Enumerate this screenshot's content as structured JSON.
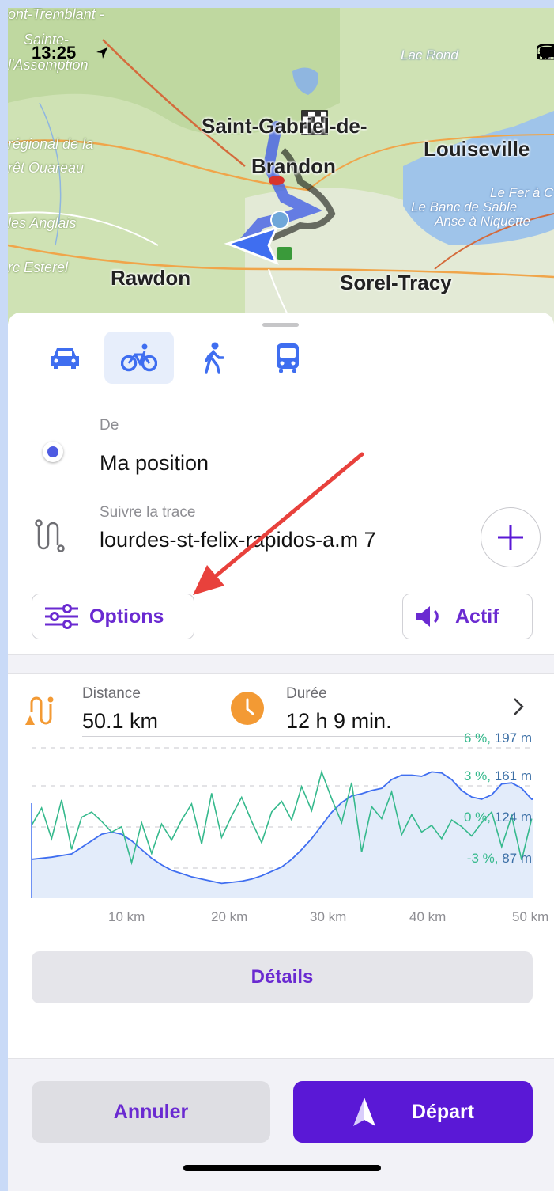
{
  "status": {
    "time": "13:25"
  },
  "map": {
    "labels": {
      "tremblant": "ont-Tremblant -",
      "assomption": "l'Assomption",
      "sainte": "Sainte-",
      "lac_rond": "Lac Rond",
      "saint_gabriel": "Saint-Gabriel-de-",
      "brandon": "Brandon",
      "louiseville": "Louiseville",
      "regional": "régional de la",
      "ouareau": "rêt Ouareau",
      "fer": "Le Fer à C",
      "banc": "Le Banc de Sable",
      "anse": "Anse à Niquette",
      "anglais": "les Anglais",
      "esterel": "rc Esterel",
      "rawdon": "Rawdon",
      "sorel": "Sorel-Tracy"
    }
  },
  "modes": [
    {
      "name": "car",
      "active": false
    },
    {
      "name": "bicycle",
      "active": true
    },
    {
      "name": "walk",
      "active": false
    },
    {
      "name": "bus",
      "active": false
    }
  ],
  "route": {
    "from_label": "De",
    "from_value": "Ma position",
    "track_label": "Suivre la trace",
    "track_value": "lourdes-st-felix-rapidos-a.m 7"
  },
  "buttons": {
    "options": "Options",
    "voice": "Actif",
    "details": "Détails",
    "cancel": "Annuler",
    "start": "Départ"
  },
  "summary": {
    "distance_label": "Distance",
    "distance_value": "50.1 km",
    "duration_label": "Durée",
    "duration_value": "12 h 9 min."
  },
  "chart_data": {
    "type": "area",
    "x_ticks": [
      "10 km",
      "20 km",
      "30 km",
      "40 km",
      "50 km"
    ],
    "right_labels": [
      {
        "grade": "6 %",
        "elev": "197 m"
      },
      {
        "grade": "3 %",
        "elev": "161 m"
      },
      {
        "grade": "0 %",
        "elev": "124 m"
      },
      {
        "grade": "-3 %",
        "elev": "87 m"
      }
    ],
    "xlim": [
      0,
      50.1
    ],
    "elevation_ylim": [
      87,
      197
    ],
    "grade_ylim": [
      -3,
      6
    ],
    "elevation": {
      "x": [
        0,
        2,
        4,
        5,
        6,
        7,
        8,
        9,
        10,
        11,
        12,
        13,
        14,
        15,
        16,
        17,
        18,
        19,
        20,
        21,
        22,
        23,
        24,
        25,
        26,
        27,
        28,
        29,
        30,
        31,
        32,
        33,
        34,
        35,
        36,
        37,
        38,
        39,
        40,
        41,
        42,
        43,
        44,
        45,
        46,
        47,
        48,
        49,
        50,
        50.1
      ],
      "y": [
        95,
        97,
        100,
        106,
        112,
        118,
        120,
        118,
        112,
        104,
        96,
        90,
        85,
        82,
        79,
        77,
        75,
        73,
        74,
        75,
        77,
        80,
        84,
        88,
        95,
        104,
        114,
        126,
        138,
        147,
        153,
        155,
        158,
        160,
        168,
        172,
        172,
        171,
        175,
        174,
        168,
        158,
        152,
        150,
        154,
        164,
        165,
        160,
        150,
        150
      ]
    },
    "grade": {
      "x": [
        0,
        1,
        2,
        3,
        4,
        5,
        6,
        7,
        8,
        9,
        10,
        11,
        12,
        13,
        14,
        15,
        16,
        17,
        18,
        19,
        20,
        21,
        22,
        23,
        24,
        25,
        26,
        27,
        28,
        29,
        30,
        31,
        32,
        33,
        34,
        35,
        36,
        37,
        38,
        39,
        40,
        41,
        42,
        43,
        44,
        45,
        46,
        47,
        48,
        49,
        50
      ],
      "y": [
        0.2,
        1.5,
        -0.8,
        2.1,
        -1.6,
        0.8,
        1.2,
        0.5,
        -0.3,
        0.1,
        -2.6,
        0.4,
        -1.9,
        0.3,
        -0.9,
        0.6,
        1.8,
        -1.2,
        2.6,
        -0.7,
        0.9,
        2.3,
        0.5,
        -1.1,
        1.2,
        2.0,
        0.6,
        3.1,
        1.3,
        4.2,
        2.2,
        0.4,
        3.4,
        -1.8,
        1.6,
        0.7,
        2.7,
        -0.5,
        1.0,
        -0.3,
        0.2,
        -0.8,
        0.6,
        0.1,
        -0.6,
        0.4,
        1.2,
        -1.4,
        0.9,
        -2.4,
        0.7
      ]
    }
  }
}
